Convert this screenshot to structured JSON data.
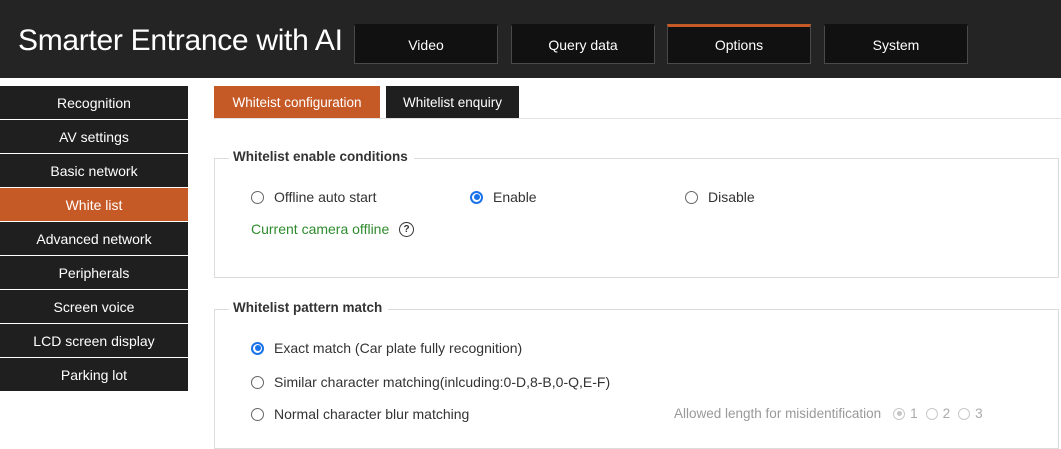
{
  "header": {
    "title": "Smarter Entrance with AI",
    "tabs": [
      {
        "label": "Video",
        "active": false
      },
      {
        "label": "Query data",
        "active": false
      },
      {
        "label": "Options",
        "active": true
      },
      {
        "label": "System",
        "active": false
      }
    ]
  },
  "sidebar": {
    "items": [
      {
        "label": "Recognition",
        "active": false
      },
      {
        "label": "AV settings",
        "active": false
      },
      {
        "label": "Basic network",
        "active": false
      },
      {
        "label": "White list",
        "active": true
      },
      {
        "label": "Advanced network",
        "active": false
      },
      {
        "label": "Peripherals",
        "active": false
      },
      {
        "label": "Screen voice",
        "active": false
      },
      {
        "label": "LCD screen display",
        "active": false
      },
      {
        "label": "Parking lot",
        "active": false
      }
    ]
  },
  "subtabs": [
    {
      "label": "Whiteist configuration",
      "active": true
    },
    {
      "label": "Whitelist enquiry",
      "active": false
    }
  ],
  "enable_section": {
    "legend": "Whitelist enable conditions",
    "options": [
      {
        "label": "Offline auto start",
        "checked": false
      },
      {
        "label": "Enable",
        "checked": true
      },
      {
        "label": "Disable",
        "checked": false
      }
    ],
    "status_text": "Current camera offline",
    "help_icon_text": "?"
  },
  "pattern_section": {
    "legend": "Whitelist pattern match",
    "options": [
      {
        "label": "Exact match (Car plate fully recognition)",
        "checked": true
      },
      {
        "label": "Similar character matching(inlcuding:0-D,8-B,0-Q,E-F)",
        "checked": false
      },
      {
        "label": "Normal character blur matching",
        "checked": false
      }
    ],
    "misidentification_label": "Allowed length for misidentification",
    "length_options": [
      {
        "label": "1",
        "checked": true
      },
      {
        "label": "2",
        "checked": false
      },
      {
        "label": "3",
        "checked": false
      }
    ]
  },
  "colors": {
    "accent": "#c65a27",
    "header_bg": "#242424",
    "sidebar_bg": "#1f1f1f",
    "radio_checked": "#1a73e8",
    "status_green": "#2e8b2e"
  },
  "icons": {
    "help": "question-circle-icon"
  }
}
